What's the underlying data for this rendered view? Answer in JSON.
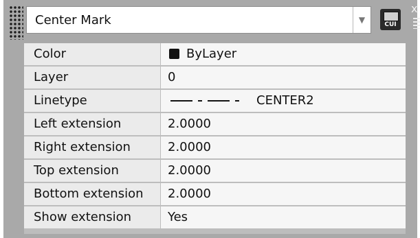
{
  "panel": {
    "selected_object": "Center Mark",
    "cui_label": "CUI",
    "close_glyph": "x"
  },
  "properties": [
    {
      "label": "Color",
      "value": "ByLayer",
      "swatch_color": "#111111"
    },
    {
      "label": "Layer",
      "value": "0"
    },
    {
      "label": "Linetype",
      "value": "CENTER2"
    },
    {
      "label": "Left extension",
      "value": "2.0000"
    },
    {
      "label": "Right extension",
      "value": "2.0000"
    },
    {
      "label": "Top extension",
      "value": "2.0000"
    },
    {
      "label": "Bottom extension",
      "value": "2.0000"
    },
    {
      "label": "Show extension",
      "value": "Yes"
    }
  ],
  "icons": {
    "dropdown_arrow": "chevron-down-icon",
    "grip": "grip-icon",
    "customize": "cui-icon",
    "close": "close-icon",
    "options": "menu-icon"
  },
  "colors": {
    "panel_bg": "#a9a9a9",
    "label_cell": "#ebebeb",
    "value_cell": "#f6f6f6"
  }
}
